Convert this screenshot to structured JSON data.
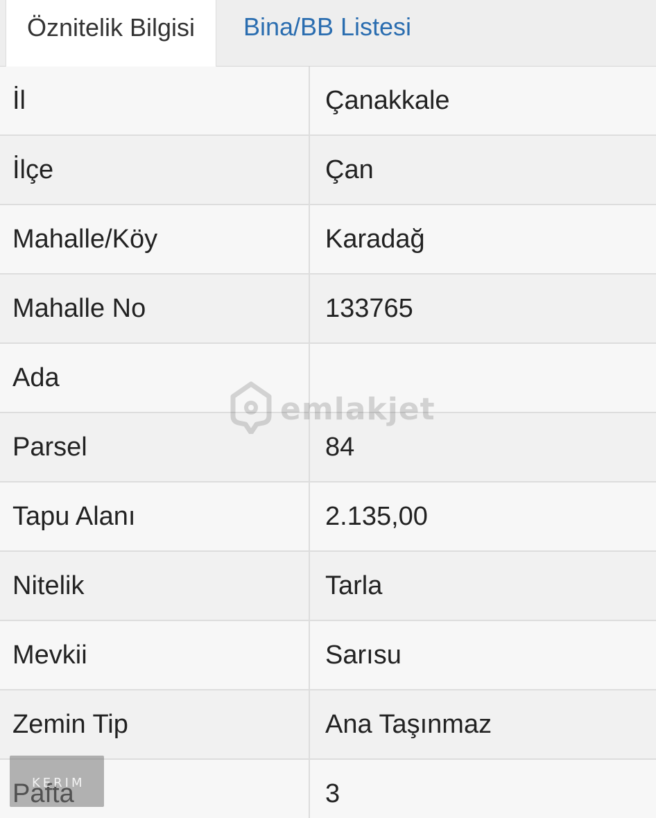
{
  "tabs": [
    {
      "label": "Öznitelik Bilgisi",
      "active": true
    },
    {
      "label": "Bina/BB Listesi",
      "active": false
    }
  ],
  "rows": [
    {
      "key": "İl",
      "value": "Çanakkale"
    },
    {
      "key": "İlçe",
      "value": "Çan"
    },
    {
      "key": "Mahalle/Köy",
      "value": "Karadağ"
    },
    {
      "key": "Mahalle No",
      "value": "133765"
    },
    {
      "key": "Ada",
      "value": ""
    },
    {
      "key": "Parsel",
      "value": "84"
    },
    {
      "key": "Tapu Alanı",
      "value": "2.135,00"
    },
    {
      "key": "Nitelik",
      "value": "Tarla"
    },
    {
      "key": "Mevkii",
      "value": "Sarısu"
    },
    {
      "key": "Zemin Tip",
      "value": "Ana Taşınmaz"
    },
    {
      "key": "Pafta",
      "value": "3"
    }
  ],
  "watermark": {
    "text": "emlakjet",
    "icon": "location-pin-house-icon"
  },
  "stamp": {
    "text": "KERIM"
  },
  "colors": {
    "tab_link": "#2a6db0",
    "row_divider": "#dddddd",
    "tabbar_bg": "#eeeeee"
  }
}
